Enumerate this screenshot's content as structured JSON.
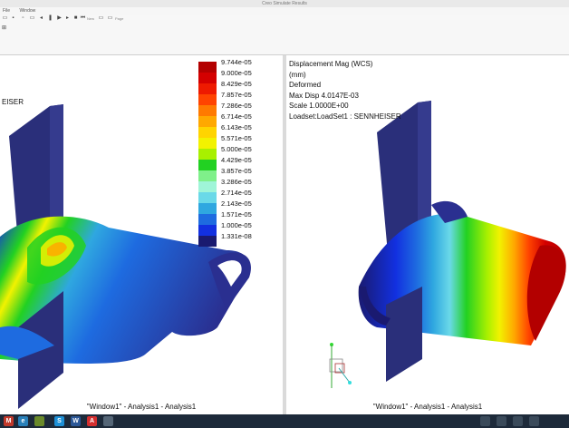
{
  "window": {
    "title": "Creo Simulate Results"
  },
  "menu": [
    "File",
    "Window"
  ],
  "toolbar": {
    "small_labels": [
      "New",
      "Page"
    ]
  },
  "left_viewport": {
    "partial_label": "EISER",
    "caption": "\"Window1\" - Analysis1 - Analysis1",
    "legend": {
      "values": [
        "9.744e-05",
        "9.000e-05",
        "8.429e-05",
        "7.857e-05",
        "7.286e-05",
        "6.714e-05",
        "6.143e-05",
        "5.571e-05",
        "5.000e-05",
        "4.429e-05",
        "3.857e-05",
        "3.286e-05",
        "2.714e-05",
        "2.143e-05",
        "1.571e-05",
        "1.000e-05",
        "1.331e-08"
      ],
      "colors": [
        "#b30000",
        "#d40000",
        "#ee1a00",
        "#ff4400",
        "#ff7a00",
        "#ffa800",
        "#ffd400",
        "#f2f200",
        "#a8f000",
        "#22d122",
        "#7ff08a",
        "#9ff5d8",
        "#6ad9e8",
        "#2fa7e0",
        "#1e6be0",
        "#1230e0",
        "#1a1a70"
      ]
    }
  },
  "right_viewport": {
    "info_lines": [
      "Displacement Mag (WCS)",
      "(mm)",
      "Deformed",
      "Max Disp  4.0147E-03",
      "Scale  1.0000E+00",
      "Loadset:LoadSet1 :  SENNHEISER"
    ],
    "caption": "\"Window1\" - Analysis1 - Analysis1"
  },
  "taskbar": {
    "icons": [
      "M",
      "e",
      "S",
      "W",
      "A"
    ]
  }
}
